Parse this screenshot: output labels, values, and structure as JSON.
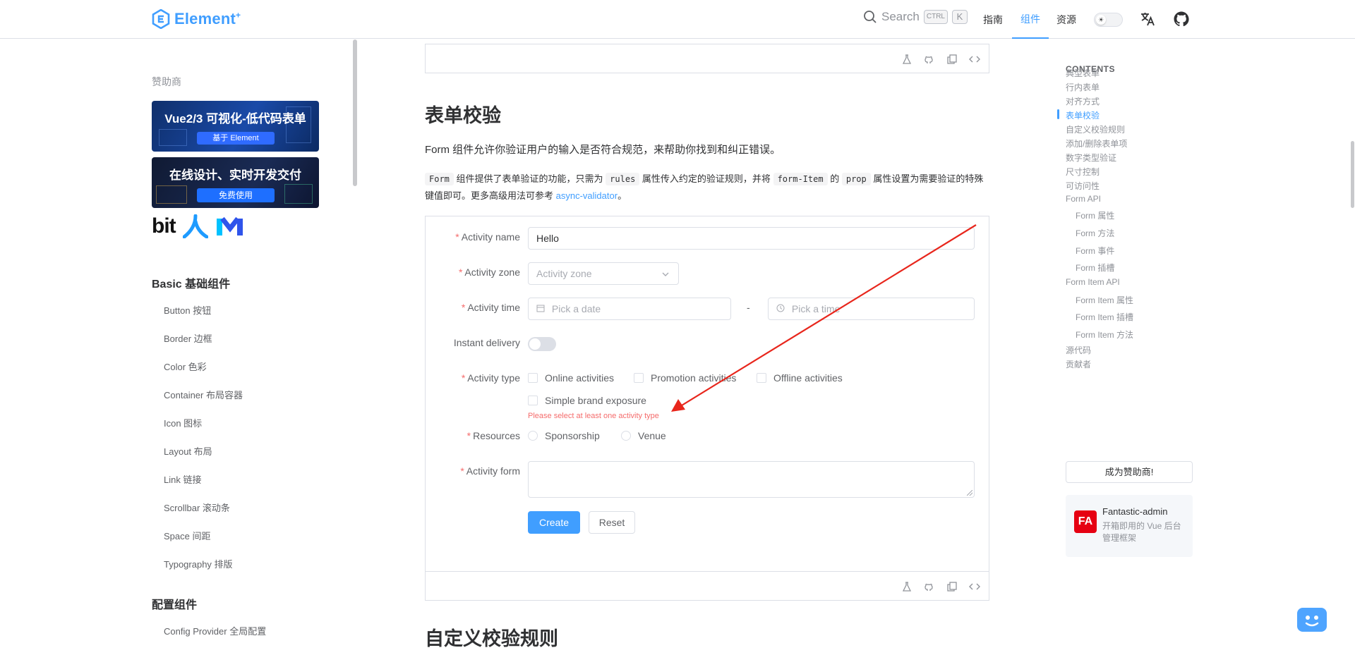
{
  "header": {
    "logo_text": "Element",
    "logo_sup": "+",
    "search_label": "Search",
    "kbd_ctrl": "CTRL",
    "kbd_k": "K",
    "nav": [
      "指南",
      "组件",
      "资源"
    ],
    "active_nav": "组件"
  },
  "sidebar": {
    "sponsor_title": "赞助商",
    "banner1_title": "Vue2/3 可视化-低代码表单",
    "banner1_pill": "基于 Element",
    "banner2_title": "在线设计、实时开发交付",
    "banner2_pill": "免费使用",
    "bit_text": "bit",
    "group1": "Basic 基础组件",
    "items1": [
      "Button 按钮",
      "Border 边框",
      "Color 色彩",
      "Container 布局容器",
      "Icon 图标",
      "Layout 布局",
      "Link 链接",
      "Scrollbar 滚动条",
      "Space 间距",
      "Typography 排版"
    ],
    "group2": "配置组件",
    "items2": [
      "Config Provider 全局配置"
    ]
  },
  "main": {
    "heading": "表单校验",
    "intro": "Form 组件允许你验证用户的输入是否符合规范，来帮助你找到和纠正错误。",
    "desc": {
      "code1": "Form",
      "t1": "组件提供了表单验证的功能，只需为",
      "code2": "rules",
      "t2": "属性传入约定的验证规则，并将",
      "code3": "form-Item",
      "t3": "的",
      "code4": "prop",
      "t4": "属性设置为需要验证的特殊键值即可。更多高级用法可参考",
      "link": "async-validator",
      "t5": "。"
    },
    "form": {
      "name_label": "Activity name",
      "name_value": "Hello",
      "zone_label": "Activity zone",
      "zone_placeholder": "Activity zone",
      "time_label": "Activity time",
      "date_placeholder": "Pick a date",
      "time_sep": "-",
      "time_placeholder": "Pick a time",
      "delivery_label": "Instant delivery",
      "type_label": "Activity type",
      "types": [
        "Online activities",
        "Promotion activities",
        "Offline activities",
        "Simple brand exposure"
      ],
      "type_error": "Please select at least one activity type",
      "resources_label": "Resources",
      "resources": [
        "Sponsorship",
        "Venue"
      ],
      "form_label": "Activity form",
      "create": "Create",
      "reset": "Reset"
    },
    "next_heading": "自定义校验规则"
  },
  "toc": {
    "title": "CONTENTS",
    "items": [
      {
        "label": "典型表单",
        "sub": false
      },
      {
        "label": "行内表单",
        "sub": false
      },
      {
        "label": "对齐方式",
        "sub": false
      },
      {
        "label": "表单校验",
        "sub": false,
        "active": true
      },
      {
        "label": "自定义校验规则",
        "sub": false
      },
      {
        "label": "添加/删除表单项",
        "sub": false
      },
      {
        "label": "数字类型验证",
        "sub": false
      },
      {
        "label": "尺寸控制",
        "sub": false
      },
      {
        "label": "可访问性",
        "sub": false
      },
      {
        "label": "Form API",
        "sub": false
      },
      {
        "label": "Form 属性",
        "sub": true
      },
      {
        "label": "Form 方法",
        "sub": true
      },
      {
        "label": "Form 事件",
        "sub": true
      },
      {
        "label": "Form 插槽",
        "sub": true
      },
      {
        "label": "Form Item API",
        "sub": false
      },
      {
        "label": "Form Item 属性",
        "sub": true
      },
      {
        "label": "Form Item 插槽",
        "sub": true
      },
      {
        "label": "Form Item 方法",
        "sub": true
      },
      {
        "label": "源代码",
        "sub": false
      },
      {
        "label": "贡献者",
        "sub": false
      }
    ],
    "sponsor_button": "成为赞助商!",
    "fa_logo": "FA",
    "fa_name": "Fantastic-admin",
    "fa_desc": "开箱即用的 Vue 后台管理框架"
  },
  "colors": {
    "accent": "#409eff",
    "error": "#f56c6c",
    "arrow": "#e8261c"
  }
}
